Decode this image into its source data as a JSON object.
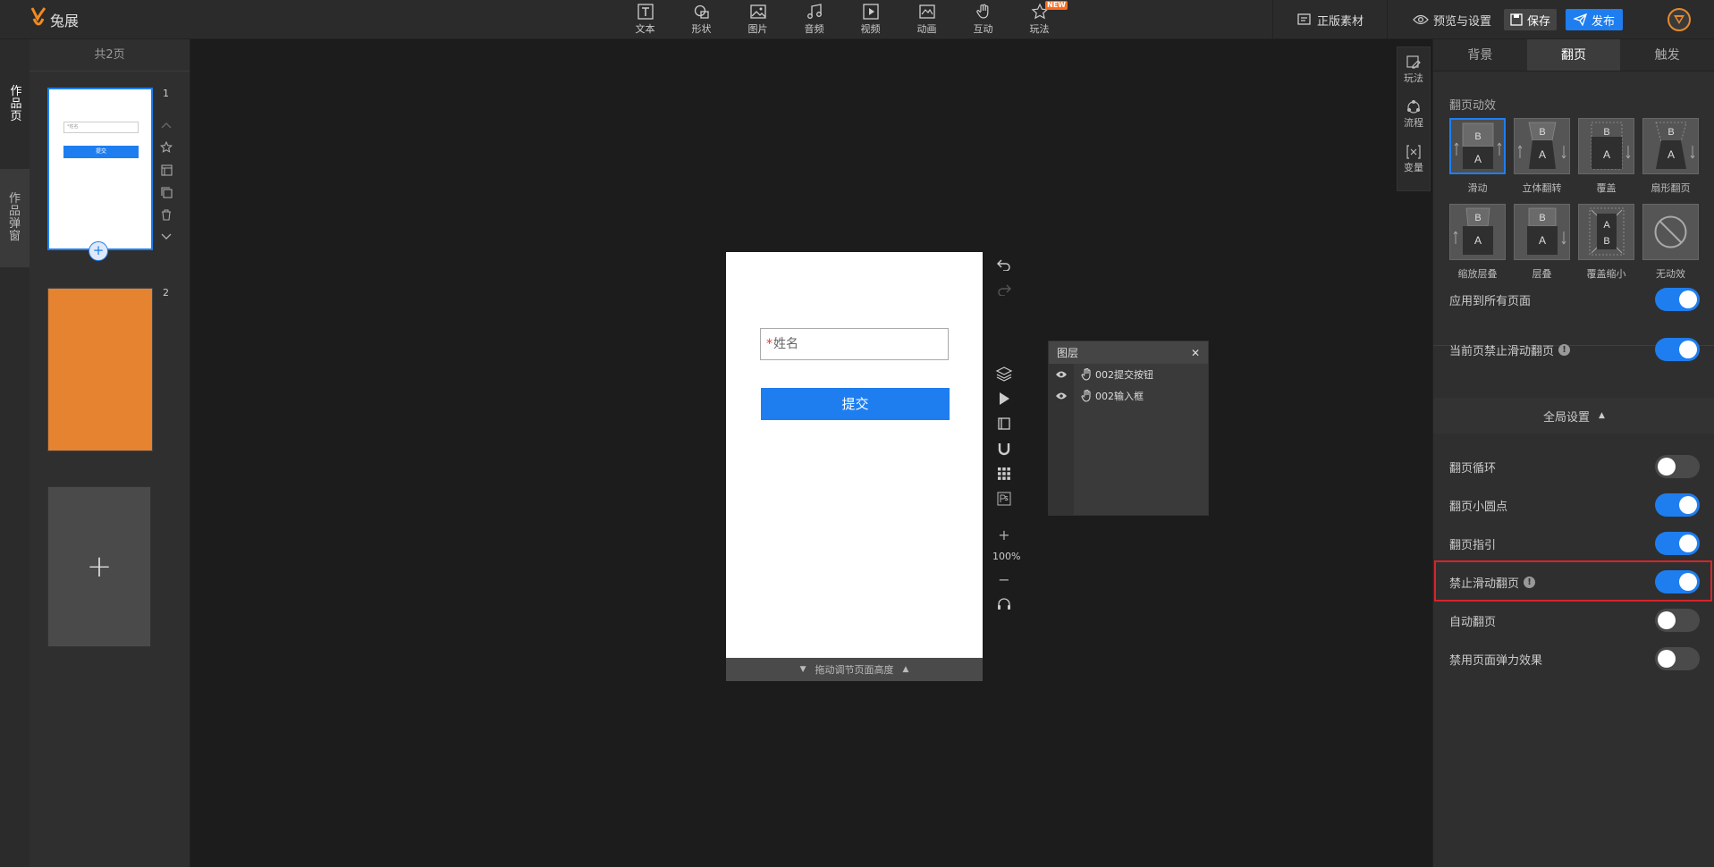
{
  "app": {
    "logo_text": "兔展"
  },
  "toolbar": {
    "tools": [
      {
        "label": "文本",
        "icon": "text-icon"
      },
      {
        "label": "形状",
        "icon": "shape-icon"
      },
      {
        "label": "图片",
        "icon": "image-icon"
      },
      {
        "label": "音频",
        "icon": "music-icon"
      },
      {
        "label": "视频",
        "icon": "video-icon"
      },
      {
        "label": "动画",
        "icon": "animation-icon"
      },
      {
        "label": "互动",
        "icon": "hand-icon"
      },
      {
        "label": "玩法",
        "icon": "star-icon",
        "badge": "NEW"
      }
    ],
    "material_label": "正版素材",
    "preview_label": "预览与设置",
    "save_label": "保存",
    "publish_label": "发布"
  },
  "left_tabs": {
    "works_page": "作品页",
    "works_popup": "作品弹窗"
  },
  "pages_panel": {
    "header": "共2页",
    "pages": [
      {
        "number": "1",
        "input_placeholder": "*姓名",
        "button_label": "提交"
      },
      {
        "number": "2"
      }
    ],
    "add_symbol": "+",
    "add_page_symbol": "+"
  },
  "canvas": {
    "input_required_mark": "*",
    "input_placeholder": "姓名",
    "submit_label": "提交",
    "resize_label": "拖动调节页面高度",
    "zoom": "100%",
    "zoom_in": "+",
    "zoom_out": "−"
  },
  "layers": {
    "title": "图层",
    "close": "✕",
    "items": [
      {
        "name": "002提交按钮"
      },
      {
        "name": "002输入框"
      }
    ]
  },
  "right_strip": {
    "items": [
      "玩法",
      "流程",
      "变量"
    ]
  },
  "right_panel": {
    "tabs": [
      "背景",
      "翻页",
      "触发"
    ],
    "active_tab": 1,
    "effects_title": "翻页动效",
    "effects": [
      {
        "label": "滑动",
        "selected": true
      },
      {
        "label": "立体翻转"
      },
      {
        "label": "覆盖"
      },
      {
        "label": "扇形翻页"
      },
      {
        "label": "缩放层叠"
      },
      {
        "label": "层叠"
      },
      {
        "label": "覆盖缩小"
      },
      {
        "label": "无动效"
      }
    ],
    "apply_all": {
      "label": "应用到所有页面",
      "on": true
    },
    "disable_current": {
      "label": "当前页禁止滑动翻页",
      "on": true
    },
    "global_settings": "全局设置",
    "global": [
      {
        "label": "翻页循环",
        "on": false
      },
      {
        "label": "翻页小圆点",
        "on": true
      },
      {
        "label": "翻页指引",
        "on": true
      },
      {
        "label": "禁止滑动翻页",
        "on": true,
        "info": true
      },
      {
        "label": "自动翻页",
        "on": false
      },
      {
        "label": "禁用页面弹力效果",
        "on": false
      }
    ],
    "info_mark": "!",
    "effect_letters": {
      "a": "A",
      "b": "B"
    }
  },
  "colors": {
    "accent": "#1e7ef0",
    "highlight": "#d8232a",
    "page2": "#e58330"
  }
}
